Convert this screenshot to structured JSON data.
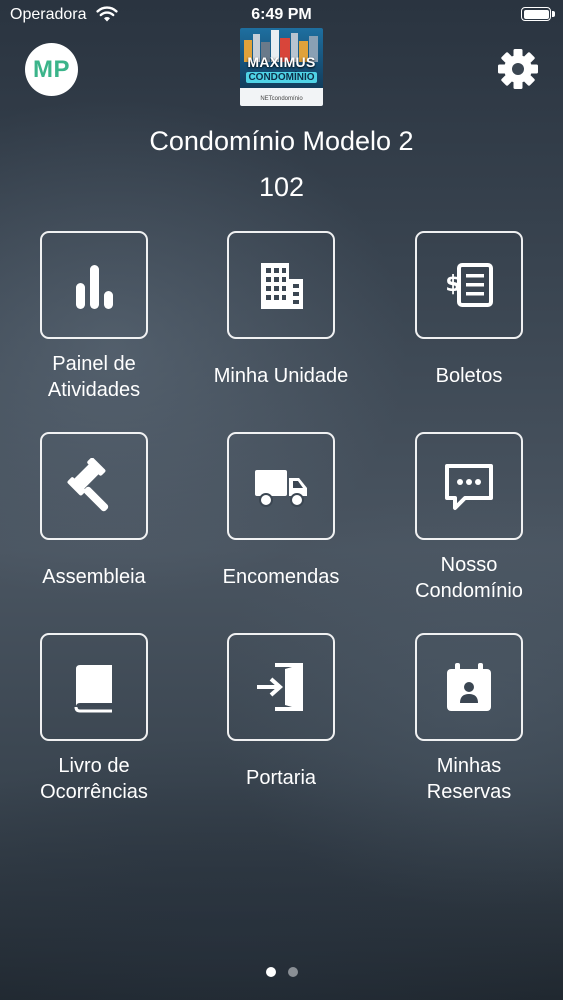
{
  "status_bar": {
    "carrier": "Operadora",
    "time": "6:49 PM"
  },
  "header": {
    "avatar_initials": "MP",
    "avatar_color": "#3bb48a",
    "logo_title": "MAXIMUS",
    "logo_subtitle": "CONDOMÍNIO",
    "logo_foot": "NETcondomínio",
    "settings_icon": "gear-icon"
  },
  "condo": {
    "name": "Condomínio Modelo 2",
    "unit": "102"
  },
  "tiles": [
    {
      "label": "Painel de\nAtividades",
      "icon": "bar-chart-icon"
    },
    {
      "label": "Minha Unidade",
      "icon": "building-icon"
    },
    {
      "label": "Boletos",
      "icon": "invoice-icon"
    },
    {
      "label": "Assembleia",
      "icon": "gavel-icon"
    },
    {
      "label": "Encomendas",
      "icon": "truck-icon"
    },
    {
      "label": "Nosso\nCondomínio",
      "icon": "chat-icon"
    },
    {
      "label": "Livro de\nOcorrências",
      "icon": "book-icon"
    },
    {
      "label": "Portaria",
      "icon": "door-enter-icon"
    },
    {
      "label": "Minhas\nReservas",
      "icon": "calendar-person-icon"
    }
  ],
  "pagination": {
    "current_page": 1,
    "total_pages": 2
  }
}
